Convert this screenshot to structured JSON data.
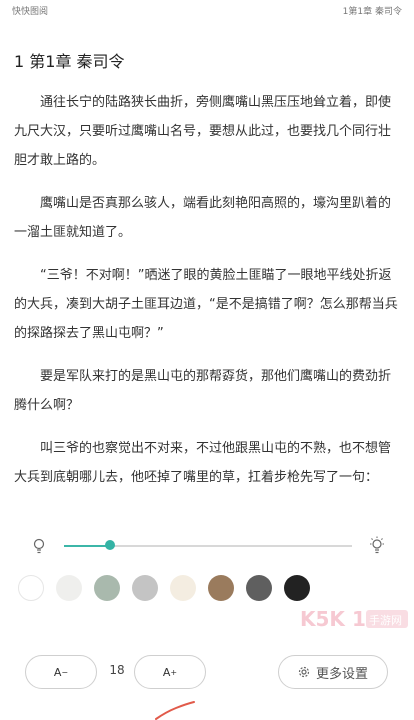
{
  "status_bar": {
    "left": "快快图阅",
    "right": "1第1章 秦司令"
  },
  "chapter_title": "1 第1章 秦司令",
  "paragraphs": [
    "通往长宁的陆路狭长曲折，旁侧鹰嘴山黑压压地耸立着，即使九尺大汉，只要听过鹰嘴山名号，要想从此过，也要找几个同行壮胆才敢上路的。",
    "鹰嘴山是否真那么骇人，端看此刻艳阳高照的，壕沟里趴着的一溜土匪就知道了。",
    "“三爷！不对啊！”晒迷了眼的黄脸土匪瞄了一眼地平线处折返的大兵，凑到大胡子土匪耳边道，“是不是搞错了啊？怎么那帮当兵的探路探去了黑山屯啊？”",
    "要是军队来打的是黑山屯的那帮孬货，那他们鹰嘴山的费劲折腾什么啊？",
    "叫三爷的也察觉出不对来，不过他跟黑山屯的不熟，也不想管大兵到底朝哪儿去，他呸掉了嘴里的草，扛着步枪先写了一句："
  ],
  "brightness": {
    "level": 0.16
  },
  "bg_colors": [
    "#ffffff",
    "#efefed",
    "#a9b9ad",
    "#c4c4c4",
    "#f4ede1",
    "#9a7b5d",
    "#5f5f5f",
    "#222222"
  ],
  "controls": {
    "decrease_label": "A",
    "decrease_sup": "−",
    "font_size": "18",
    "increase_label": "A",
    "increase_sup": "+",
    "more_settings": "更多设置"
  },
  "watermark": "K5K1手游网"
}
